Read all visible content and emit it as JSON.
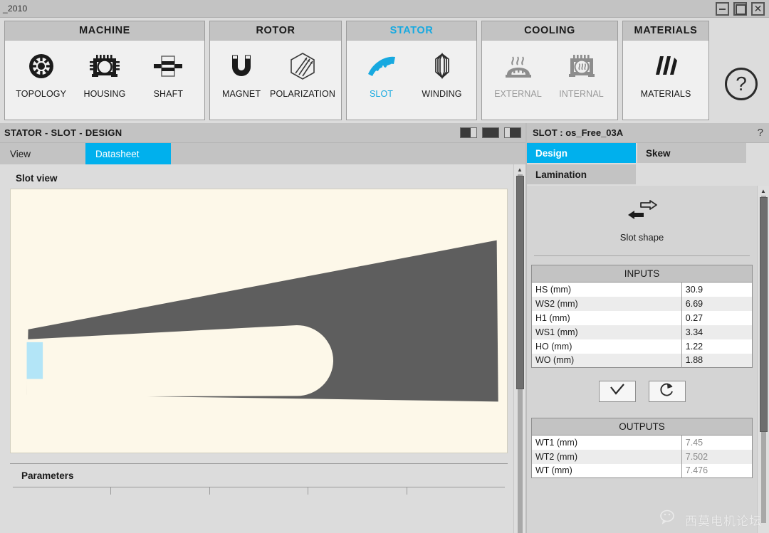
{
  "window": {
    "title": "_2010",
    "buttons": [
      {
        "name": "minimize",
        "glyph": "–"
      },
      {
        "name": "maximize",
        "glyph": "□"
      },
      {
        "name": "close",
        "glyph": "✕"
      }
    ]
  },
  "ribbon": {
    "groups": [
      {
        "id": "machine",
        "title": "MACHINE",
        "accent": false,
        "items": [
          {
            "label": "TOPOLOGY",
            "icon": "topology-icon",
            "state": "normal"
          },
          {
            "label": "HOUSING",
            "icon": "housing-icon",
            "state": "normal"
          },
          {
            "label": "SHAFT",
            "icon": "shaft-icon",
            "state": "normal"
          }
        ]
      },
      {
        "id": "rotor",
        "title": "ROTOR",
        "accent": false,
        "items": [
          {
            "label": "MAGNET",
            "icon": "magnet-icon",
            "state": "normal"
          },
          {
            "label": "POLARIZATION",
            "icon": "polarization-icon",
            "state": "normal"
          }
        ]
      },
      {
        "id": "stator",
        "title": "STATOR",
        "accent": true,
        "items": [
          {
            "label": "SLOT",
            "icon": "slot-icon",
            "state": "active"
          },
          {
            "label": "WINDING",
            "icon": "winding-icon",
            "state": "normal"
          }
        ]
      },
      {
        "id": "cooling",
        "title": "COOLING",
        "accent": false,
        "items": [
          {
            "label": "EXTERNAL",
            "icon": "external-cooling-icon",
            "state": "disabled"
          },
          {
            "label": "INTERNAL",
            "icon": "internal-cooling-icon",
            "state": "disabled"
          }
        ]
      },
      {
        "id": "materials",
        "title": "MATERIALS",
        "accent": false,
        "items": [
          {
            "label": "MATERIALS",
            "icon": "materials-icon",
            "state": "normal"
          }
        ]
      }
    ],
    "help_glyph": "?"
  },
  "document": {
    "title": "STATOR - SLOT - DESIGN",
    "layout_buttons": [
      "layout-left-wide",
      "layout-full",
      "layout-right-wide"
    ],
    "tabs": [
      {
        "label": "View",
        "active": false
      },
      {
        "label": "Datasheet",
        "active": true
      }
    ],
    "slot_view_label": "Slot view",
    "parameters_label": "Parameters"
  },
  "slot_panel": {
    "header": "SLOT : os_Free_03A",
    "help_glyph": "?",
    "tabs": [
      {
        "label": "Design",
        "active": true
      },
      {
        "label": "Skew",
        "active": false
      },
      {
        "label": "Lamination",
        "active": false
      }
    ],
    "slot_shape": {
      "label": "Slot shape",
      "icon": "swap-arrows-icon"
    },
    "inputs": {
      "title": "INPUTS",
      "rows": [
        {
          "key": "HS (mm)",
          "value": "30.9"
        },
        {
          "key": "WS2 (mm)",
          "value": "6.69"
        },
        {
          "key": "H1 (mm)",
          "value": "0.27"
        },
        {
          "key": "WS1 (mm)",
          "value": "3.34"
        },
        {
          "key": "HO (mm)",
          "value": "1.22"
        },
        {
          "key": "WO (mm)",
          "value": "1.88"
        }
      ]
    },
    "actions": [
      {
        "name": "validate-button",
        "icon": "check-icon"
      },
      {
        "name": "reset-button",
        "icon": "reset-icon"
      }
    ],
    "outputs": {
      "title": "OUTPUTS",
      "rows": [
        {
          "key": "WT1 (mm)",
          "value": "7.45"
        },
        {
          "key": "WT2 (mm)",
          "value": "7.502"
        },
        {
          "key": "WT (mm)",
          "value": "7.476"
        }
      ]
    }
  },
  "colors": {
    "accent": "#00b0ed",
    "ribbon_bg": "#dcdcdc",
    "panel_header": "#c3c3c3",
    "canvas_bg": "#fdf8e9",
    "lamination": "#5e5e5e",
    "slot_opening": "#b3e5f7"
  },
  "watermark": {
    "text": "西莫电机论坛"
  }
}
